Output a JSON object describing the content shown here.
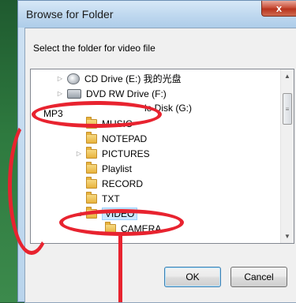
{
  "dialog": {
    "title": "Browse for Folder",
    "close_glyph": "x",
    "prompt": "Select the folder for video file"
  },
  "tree": {
    "items": [
      {
        "label": "CD Drive (E:) 我的光盘",
        "icon": "cd-drive-icon",
        "expander": "▷"
      },
      {
        "label": "DVD RW Drive (F:)",
        "icon": "dvd-rw-drive-icon",
        "expander": "▷"
      },
      {
        "label": "le Disk (G:)",
        "icon": "removable-disk-icon",
        "expander": ""
      },
      {
        "label": "MUSIC",
        "icon": "folder-icon",
        "expander": ""
      },
      {
        "label": "NOTEPAD",
        "icon": "folder-icon",
        "expander": ""
      },
      {
        "label": "PICTURES",
        "icon": "folder-icon",
        "expander": "▷"
      },
      {
        "label": "Playlist",
        "icon": "folder-icon",
        "expander": ""
      },
      {
        "label": "RECORD",
        "icon": "folder-icon",
        "expander": ""
      },
      {
        "label": "TXT",
        "icon": "folder-icon",
        "expander": ""
      },
      {
        "label": "VIDEO",
        "icon": "folder-icon",
        "expander": "◢",
        "selected": true
      },
      {
        "label": "CAMERA",
        "icon": "folder-icon",
        "expander": ""
      }
    ]
  },
  "buttons": {
    "ok": "OK",
    "cancel": "Cancel"
  },
  "annotation": {
    "mp3_label": "MP3",
    "color": "#e8232f"
  }
}
